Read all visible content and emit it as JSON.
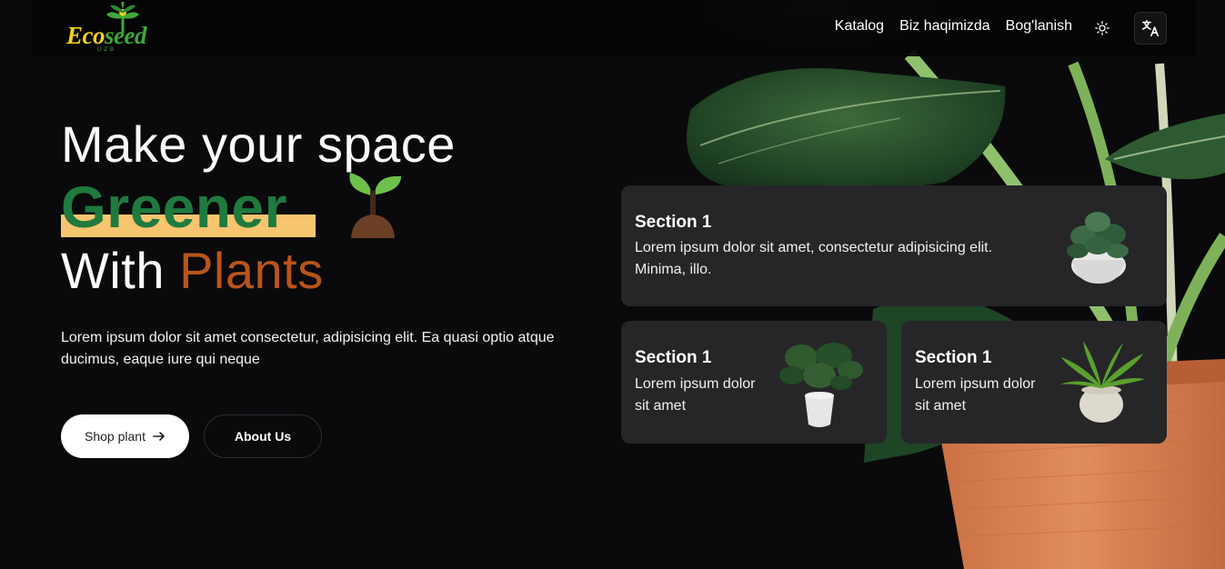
{
  "brand": {
    "logo_part1": "Eco",
    "logo_part2": "seed",
    "logo_sub": "UZB"
  },
  "nav": {
    "items": [
      {
        "label": "Katalog"
      },
      {
        "label": "Biz haqimizda"
      },
      {
        "label": "Bog'lanish"
      }
    ],
    "theme_icon": "sun-icon",
    "lang_icon": "translate-icon"
  },
  "hero": {
    "line1": "Make your space",
    "highlight": "Greener",
    "line3_prefix": "With ",
    "line3_accent": "Plants",
    "description": "Lorem ipsum dolor sit amet consectetur, adipisicing elit. Ea quasi optio atque ducimus, eaque iure qui neque",
    "shop_button": "Shop plant",
    "about_button": "About Us"
  },
  "cards": [
    {
      "title": "Section 1",
      "text": "Lorem ipsum dolor sit amet, consectetur adipisicing elit. Minima, illo."
    },
    {
      "title": "Section 1",
      "text": "Lorem ipsum dolor sit amet"
    },
    {
      "title": "Section 1",
      "text": "Lorem ipsum dolor sit amet"
    }
  ],
  "colors": {
    "background": "#0a0a0c",
    "card": "#262629",
    "green": "#1f7a3e",
    "highlight": "#f7c56f",
    "accent": "#b8541c"
  }
}
